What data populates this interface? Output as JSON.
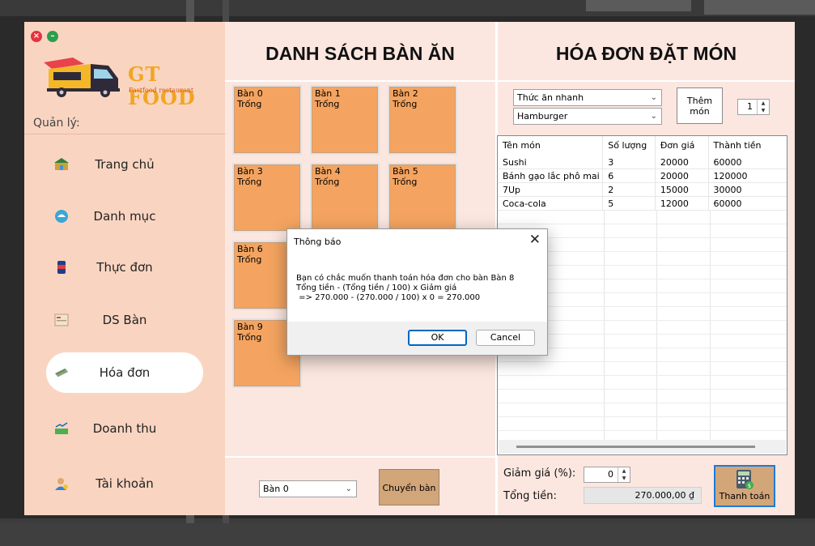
{
  "sidebar": {
    "logo_title": "GT FOOD",
    "logo_subtitle": "Fastfood restaurant",
    "section_label": "Quản lý:",
    "items": [
      {
        "label": "Trang chủ",
        "icon": "home-icon"
      },
      {
        "label": "Danh mục",
        "icon": "category-icon"
      },
      {
        "label": "Thực đơn",
        "icon": "drink-icon"
      },
      {
        "label": "DS Bàn",
        "icon": "table-list-icon"
      },
      {
        "label": "Hóa đơn",
        "icon": "invoice-icon",
        "active": true
      },
      {
        "label": "Doanh thu",
        "icon": "revenue-icon"
      },
      {
        "label": "Tài khoản",
        "icon": "account-icon"
      }
    ]
  },
  "tables_panel": {
    "title": "DANH SÁCH BÀN ĂN",
    "tables": [
      {
        "name": "Bàn 0",
        "status": "Trống"
      },
      {
        "name": "Bàn 1",
        "status": "Trống"
      },
      {
        "name": "Bàn 2",
        "status": "Trống"
      },
      {
        "name": "Bàn 3",
        "status": "Trống"
      },
      {
        "name": "Bàn 4",
        "status": "Trống"
      },
      {
        "name": "Bàn 5",
        "status": "Trống"
      },
      {
        "name": "Bàn 6",
        "status": "Trống"
      },
      {
        "name": "Bàn 9",
        "status": "Trống"
      }
    ],
    "switch_select_value": "Bàn 0",
    "switch_button": "Chuyển bàn"
  },
  "order_panel": {
    "title": "HÓA ĐƠN ĐẶT MÓN",
    "category_value": "Thức ăn nhanh",
    "food_value": "Hamburger",
    "add_button": "Thêm món",
    "quantity": "1",
    "columns": [
      "Tên món",
      "Số lượng",
      "Đơn giá",
      "Thành tiền"
    ],
    "rows": [
      [
        "Sushi",
        "3",
        "20000",
        "60000"
      ],
      [
        "Bánh gạo lắc phô mai",
        "6",
        "20000",
        "120000"
      ],
      [
        "7Up",
        "2",
        "15000",
        "30000"
      ],
      [
        "Coca-cola",
        "5",
        "12000",
        "60000"
      ]
    ],
    "discount_label": "Giảm giá (%):",
    "discount_value": "0",
    "total_label": "Tổng tiền:",
    "total_value": "270.000,00 ₫",
    "pay_button": "Thanh toán"
  },
  "dialog": {
    "title": "Thông báo",
    "message": "Bạn có chắc muốn thanh toán hóa đơn cho bàn Bàn 8\nTổng tiền - (Tổng tiền / 100) x Giảm giá\n => 270.000 - (270.000 / 100) x 0 = 270.000",
    "ok": "OK",
    "cancel": "Cancel"
  }
}
